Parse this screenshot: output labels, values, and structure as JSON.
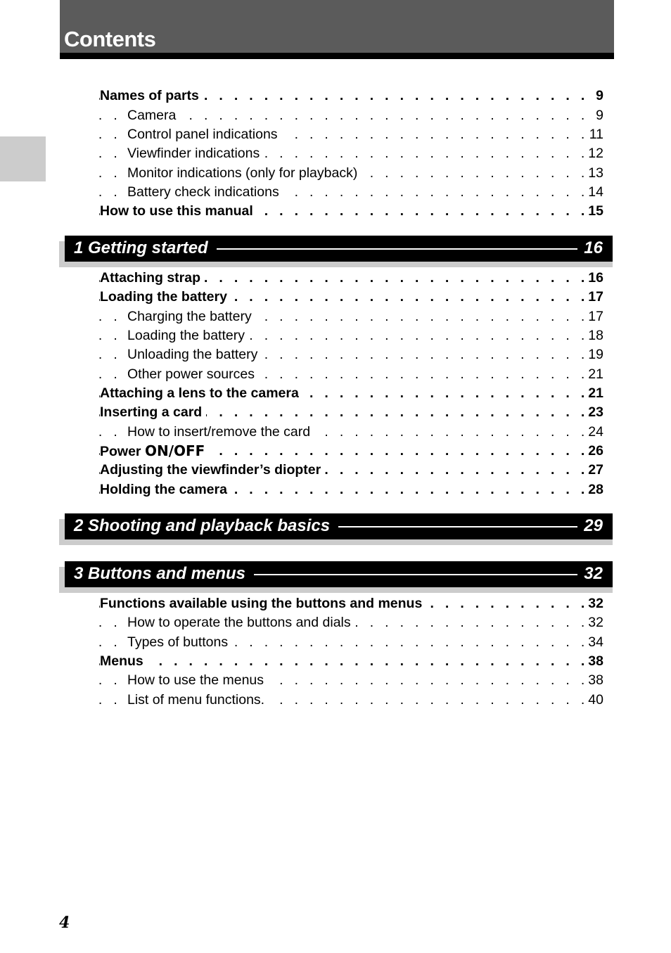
{
  "header": {
    "title": "Contents"
  },
  "intro_entries": [
    {
      "label": "Names of parts",
      "page": "9",
      "level": 1
    },
    {
      "label": "Camera",
      "page": "9",
      "level": 2
    },
    {
      "label": "Control panel indications",
      "page": "11",
      "level": 2
    },
    {
      "label": "Viewfinder indications",
      "page": "12",
      "level": 2
    },
    {
      "label": "Monitor indications (only for playback)",
      "page": "13",
      "level": 2
    },
    {
      "label": "Battery check indications",
      "page": "14",
      "level": 2
    },
    {
      "label": "How to use this manual",
      "page": "15",
      "level": 1
    }
  ],
  "sections": [
    {
      "title": "1 Getting started",
      "page": "16",
      "entries": [
        {
          "label": "Attaching strap",
          "page": "16",
          "level": 1
        },
        {
          "label": "Loading the battery",
          "page": "17",
          "level": 1
        },
        {
          "label": "Charging the battery",
          "page": "17",
          "level": 2
        },
        {
          "label": "Loading the battery",
          "page": "18",
          "level": 2
        },
        {
          "label": "Unloading the battery",
          "page": "19",
          "level": 2
        },
        {
          "label": "Other power sources",
          "page": "21",
          "level": 2
        },
        {
          "label": "Attaching a lens to the camera",
          "page": "21",
          "level": 1
        },
        {
          "label": "Inserting a card",
          "page": "23",
          "level": 1
        },
        {
          "label": "How to insert/remove the card",
          "page": "24",
          "level": 2
        },
        {
          "label": "Power",
          "label_suffix": "ON/OFF",
          "page": "26",
          "level": 1
        },
        {
          "label": "Adjusting the viewfinder’s diopter",
          "page": "27",
          "level": 1
        },
        {
          "label": "Holding the camera",
          "page": "28",
          "level": 1
        }
      ]
    },
    {
      "title": "2 Shooting and playback basics",
      "page": "29",
      "entries": []
    },
    {
      "title": "3 Buttons and menus",
      "page": "32",
      "entries": [
        {
          "label": "Functions available using the buttons and menus",
          "page": "32",
          "level": 1
        },
        {
          "label": "How to operate the buttons and dials",
          "page": "32",
          "level": 2
        },
        {
          "label": "Types of buttons",
          "page": "34",
          "level": 2
        },
        {
          "label": "Menus",
          "page": "38",
          "level": 1
        },
        {
          "label": "How to use the menus",
          "page": "38",
          "level": 2
        },
        {
          "label": "List of menu functions.",
          "page": "40",
          "level": 2
        }
      ]
    }
  ],
  "footer": {
    "page_number": "4"
  },
  "colors": {
    "title_bar": "#5b5b5b",
    "section_bar": "#000000",
    "shadow": "#cccccc"
  }
}
